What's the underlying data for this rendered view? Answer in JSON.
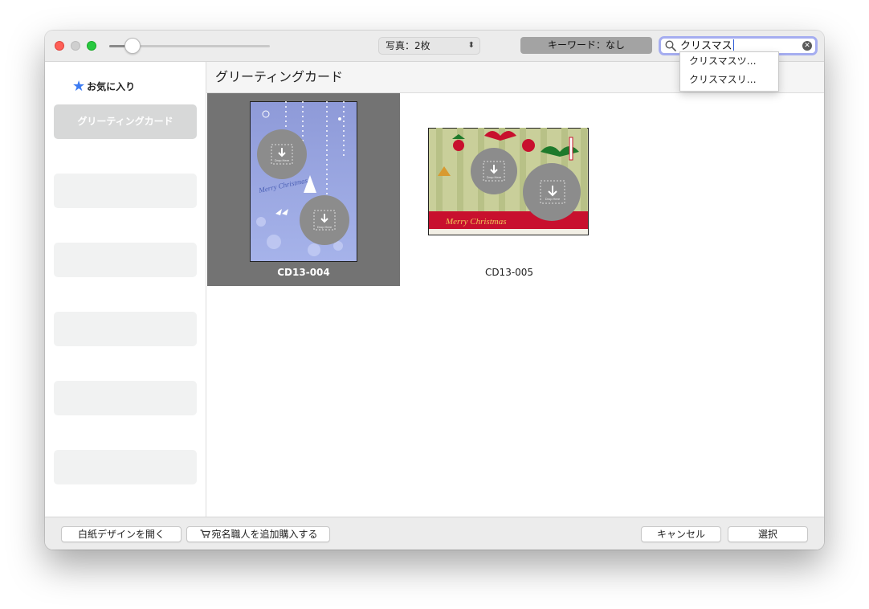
{
  "toolbar": {
    "photo_count_label": "写真：2枚",
    "keyword_badge": "キーワード：なし",
    "search_value": "クリスマス",
    "search_suggestions": [
      "クリスマスツ…",
      "クリスマスリ…"
    ]
  },
  "sidebar": {
    "favorites_label": "お気に入り",
    "selected_item": "グリーティングカード"
  },
  "main": {
    "section_title": "グリーティングカード",
    "cards": [
      {
        "id": "CD13-004",
        "overlay_text": "Merry Christmas",
        "drop_label": "Drop Here",
        "selected": true
      },
      {
        "id": "CD13-005",
        "overlay_text": "Merry Christmas",
        "drop_label": "Drop Here",
        "selected": false
      }
    ]
  },
  "footer": {
    "open_blank_button": "白紙デザインを開く",
    "purchase_button": "宛名職人を追加購入する",
    "cancel_button": "キャンセル",
    "select_button": "選択"
  },
  "colors": {
    "selection_gray": "#737373",
    "favorites_star": "#3c7bf2",
    "search_focus": "#a5adf0",
    "close_red": "#fe5f57",
    "zoom_green": "#28c840"
  }
}
